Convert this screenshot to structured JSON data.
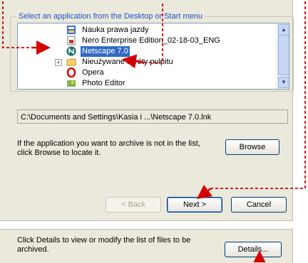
{
  "group_label": "Select an application from the Desktop or Start menu",
  "list": {
    "items": [
      {
        "label": "Nauka prawa jazdy",
        "icon": "application-icon",
        "selected": false
      },
      {
        "label": "Nero Enterprise Edition_02-18-03_ENG",
        "icon": "document-icon",
        "selected": false
      },
      {
        "label": "Netscape 7.0",
        "icon": "netscape-icon",
        "selected": true
      },
      {
        "label": "Nieużywane skróty pulpitu",
        "icon": "folder-icon",
        "selected": false
      },
      {
        "label": "Opera",
        "icon": "opera-icon",
        "selected": false
      },
      {
        "label": "Photo Editor",
        "icon": "photo-editor-icon",
        "selected": false
      }
    ]
  },
  "path_value": "C:\\Documents and Settings\\Kasia i ...\\Netscape 7.0.lnk",
  "info_text": "If the application you want to archive is not in the list, click Browse to locate it.",
  "buttons": {
    "browse": "Browse",
    "back": "< Back",
    "next": "Next >",
    "cancel": "Cancel",
    "details": "Details..."
  },
  "details_text": "Click Details to view or modify the list of files to be archived.",
  "colors": {
    "annotation_red": "#d40000",
    "selection_blue": "#316ac5",
    "group_label_blue": "#1e50c8"
  }
}
